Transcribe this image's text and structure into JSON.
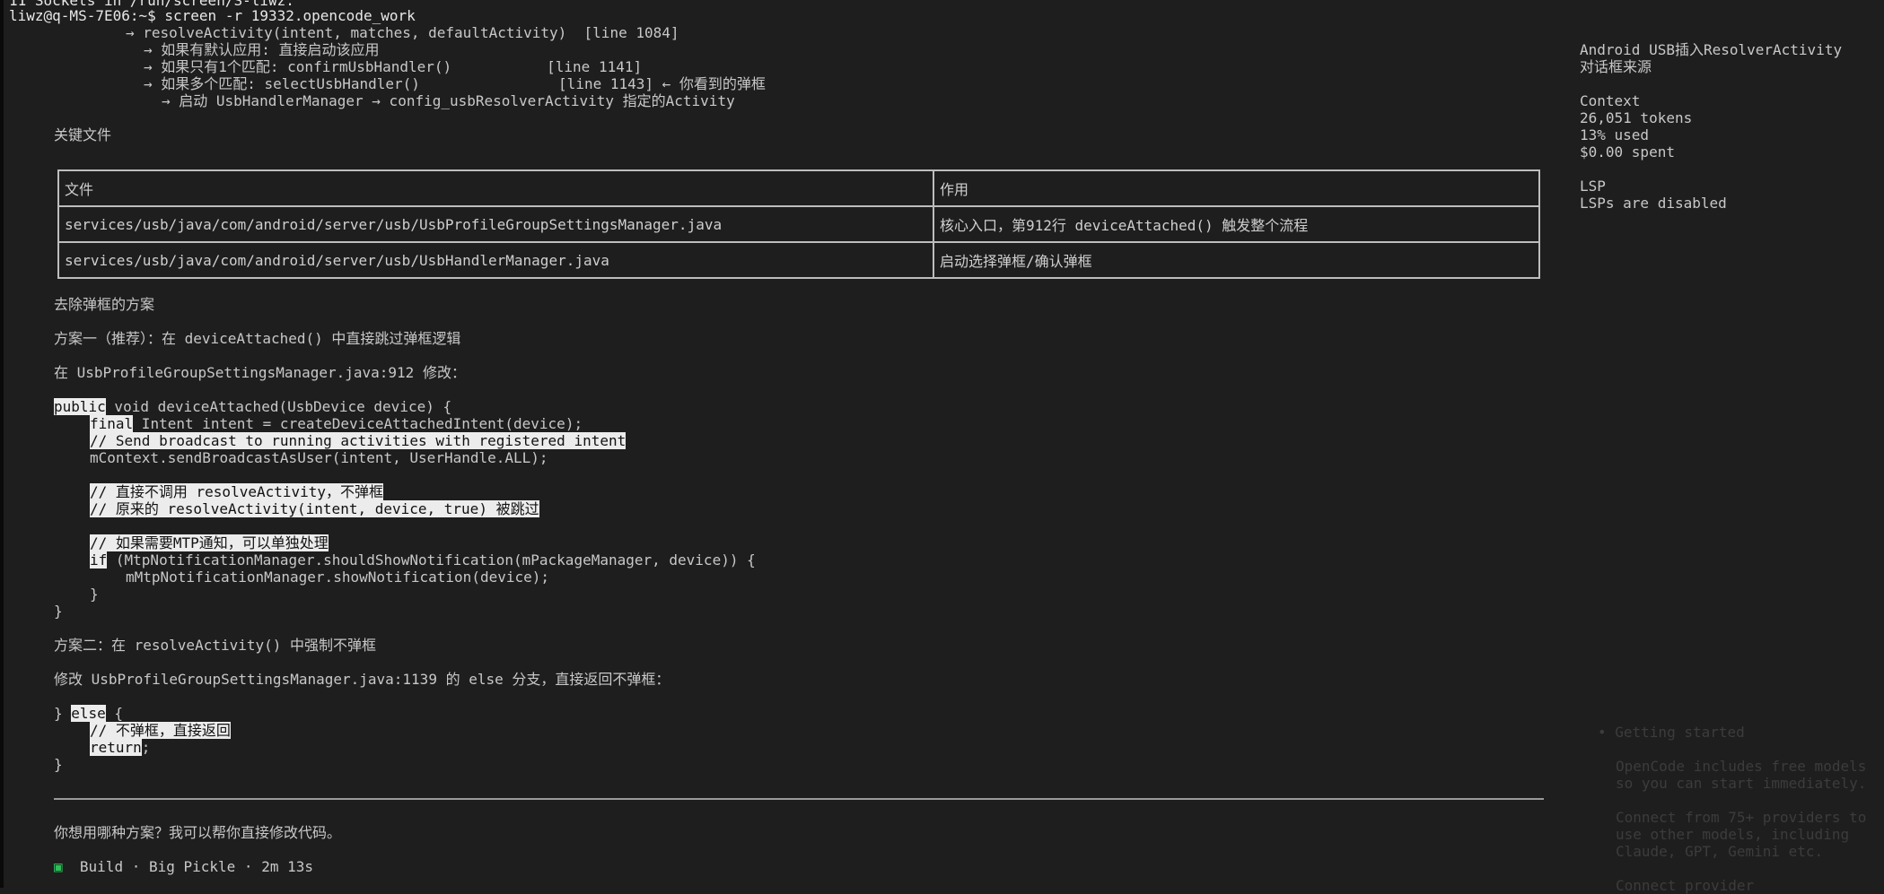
{
  "terminal": {
    "top_partial": "11 Sockets in /run/screen/S-liwz.",
    "prompt": "liwz@q-MS-7E06:~$ screen -r 19332.opencode_work",
    "flow": [
      "→ resolveActivity(intent, matches, defaultActivity)  [line 1084]",
      "→ 如果有默认应用: 直接启动该应用",
      "→ 如果只有1个匹配: confirmUsbHandler()           [line 1141]",
      "→ 如果多个匹配: selectUsbHandler()                [line 1143] ← 你看到的弹框",
      "→ 启动 UsbHandlerManager → config_usbResolverActivity 指定的Activity"
    ],
    "key_files_heading": "关键文件",
    "table": {
      "headers": [
        "文件",
        "作用"
      ],
      "rows": [
        [
          "services/usb/java/com/android/server/usb/UsbProfileGroupSettingsManager.java",
          "核心入口，第912行 deviceAttached() 触发整个流程"
        ],
        [
          "services/usb/java/com/android/server/usb/UsbHandlerManager.java",
          "启动选择弹框/确认弹框"
        ]
      ]
    },
    "remove_heading": "去除弹框的方案",
    "plan1_title": "方案一（推荐）：在 deviceAttached() 中直接跳过弹框逻辑",
    "plan1_where": "在 UsbProfileGroupSettingsManager.java:912 修改：",
    "code1": {
      "l1_kw": "public",
      "l1_rest": " void deviceAttached(UsbDevice device) {",
      "l2_kw": "final",
      "l2_rest": " Intent intent = createDeviceAttachedIntent(device);",
      "l3_comment": "// Send broadcast to running activities with registered intent",
      "l4": "mContext.sendBroadcastAsUser(intent, UserHandle.ALL);",
      "c1": "// 直接不调用 resolveActivity，不弹框",
      "c2": "// 原来的 resolveActivity(intent, device, true) 被跳过",
      "c3": "// 如果需要MTP通知，可以单独处理",
      "if_kw": "if",
      "if_rest": " (MtpNotificationManager.shouldShowNotification(mPackageManager, device)) {",
      "show": "mMtpNotificationManager.showNotification(device);",
      "close_inner": "}",
      "close_outer": "}"
    },
    "plan2_title": "方案二：在 resolveActivity() 中强制不弹框",
    "plan2_where": "修改 UsbProfileGroupSettingsManager.java:1139 的 else 分支，直接返回不弹框：",
    "code2": {
      "brace": "} ",
      "else_kw": "else",
      "else_rest": " {",
      "comment": "// 不弹框，直接返回",
      "ret_kw": "return",
      "ret_rest": ";",
      "close": "}"
    },
    "question": "你想用哪种方案？我可以帮你直接修改代码。",
    "build": {
      "icon": "▣",
      "text": "Build · Big Pickle · 2m 13s"
    }
  },
  "sidebar": {
    "title_l1": "Android USB插入ResolverActivity",
    "title_l2": "对话框来源",
    "context_heading": "Context",
    "tokens": "26,051 tokens",
    "used": "13% used",
    "spent": "$0.00 spent",
    "lsp_heading": "LSP",
    "lsp_status": "LSPs are disabled",
    "faded": {
      "title": "• Getting started",
      "p1_l1": "OpenCode includes free models",
      "p1_l2": "so you can start immediately.",
      "p2_l1": "Connect from 75+ providers to",
      "p2_l2": "use other models, including",
      "p2_l3": "Claude, GPT, Gemini etc.",
      "link": "Connect provider"
    }
  }
}
